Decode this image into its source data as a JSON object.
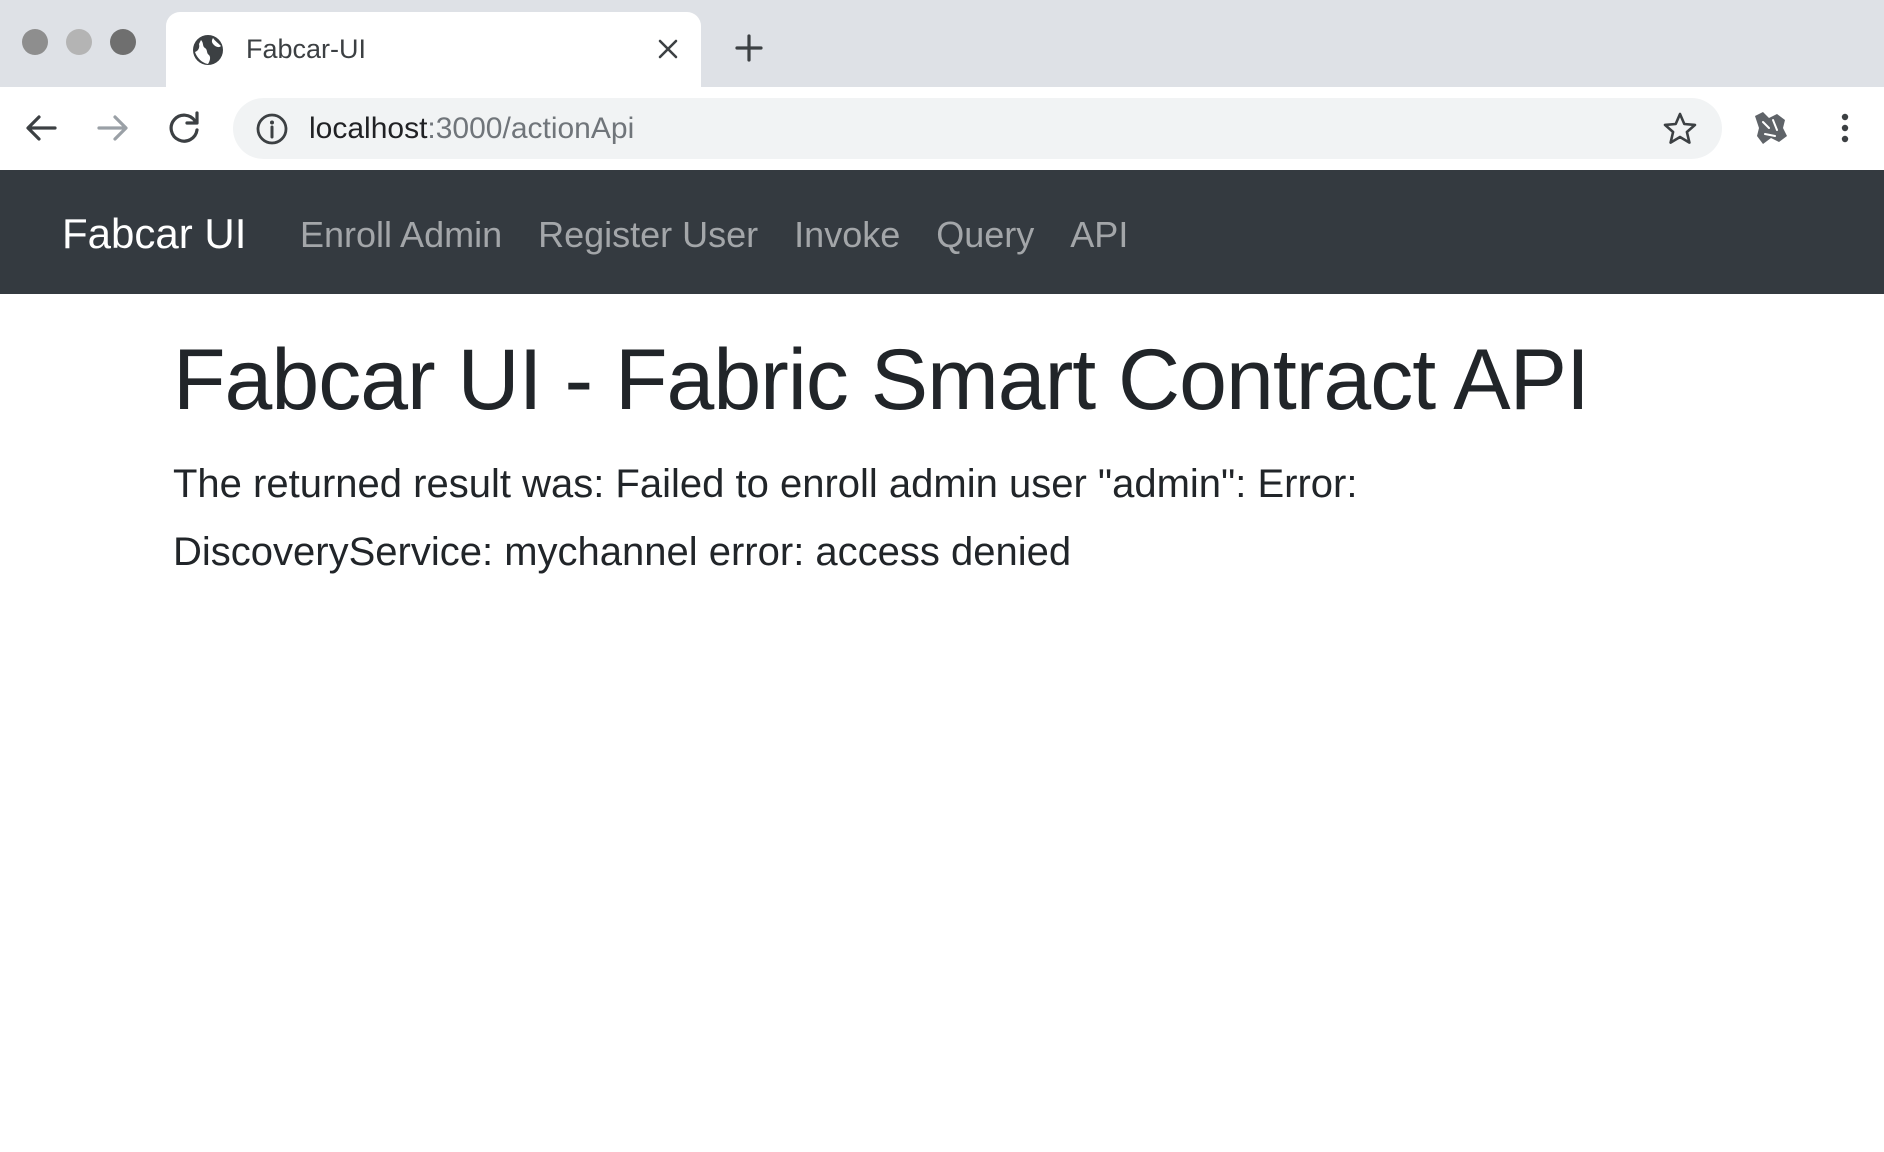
{
  "browser": {
    "tab": {
      "title": "Fabcar-UI",
      "favicon": "globe-icon"
    },
    "address": {
      "host": "localhost",
      "path": ":3000/actionApi"
    },
    "icons": {
      "back": "back-arrow-icon",
      "forward": "forward-arrow-icon",
      "reload": "reload-icon",
      "info": "info-icon",
      "bookmark": "star-icon",
      "extension": "extension-icon",
      "menu": "kebab-menu-icon",
      "new_tab": "plus-icon",
      "close_tab": "close-icon"
    }
  },
  "navbar": {
    "brand": "Fabcar UI",
    "links": [
      "Enroll Admin",
      "Register User",
      "Invoke",
      "Query",
      "API"
    ],
    "background": "#343a40"
  },
  "main": {
    "title": "Fabcar UI - Fabric Smart Contract API",
    "result_text": "The returned result was: Failed to enroll admin user \"admin\": Error: DiscoveryService: mychannel error: access denied"
  }
}
